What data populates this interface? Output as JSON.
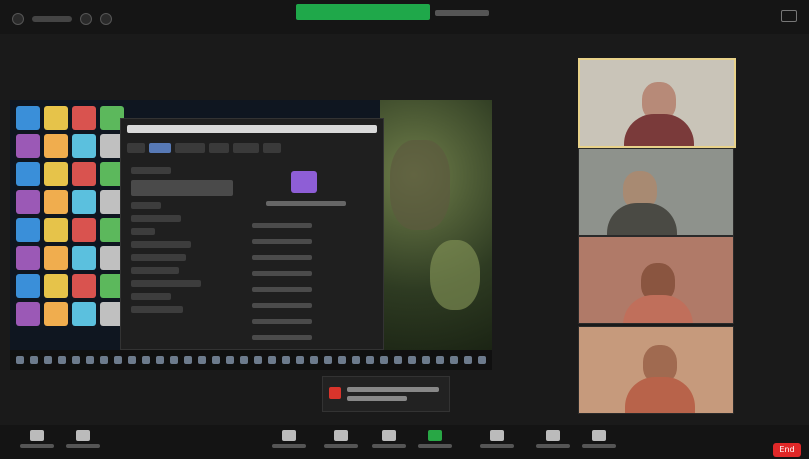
{
  "topbar": {
    "share_banner_color": "#1fa84a",
    "icons": [
      "info-icon",
      "security-icon",
      "recording-icon"
    ]
  },
  "shared_screen": {
    "explorer_folder_color": "#8e5ed6",
    "taskbar_icon_count": 34
  },
  "participants": {
    "count": 4,
    "active_speaker_index": 0
  },
  "bottombar": {
    "buttons": [
      "mute-icon",
      "video-icon",
      "participants-icon",
      "chat-icon",
      "react-icon",
      "share-screen-icon",
      "record-icon",
      "reactions-icon",
      "apps-icon",
      "more-icon"
    ],
    "end_label": "End"
  },
  "colors": {
    "background": "#1a1a1a",
    "share_green": "#1fa84a",
    "end_red": "#e02828",
    "active_speaker_border": "#e8d28a"
  }
}
